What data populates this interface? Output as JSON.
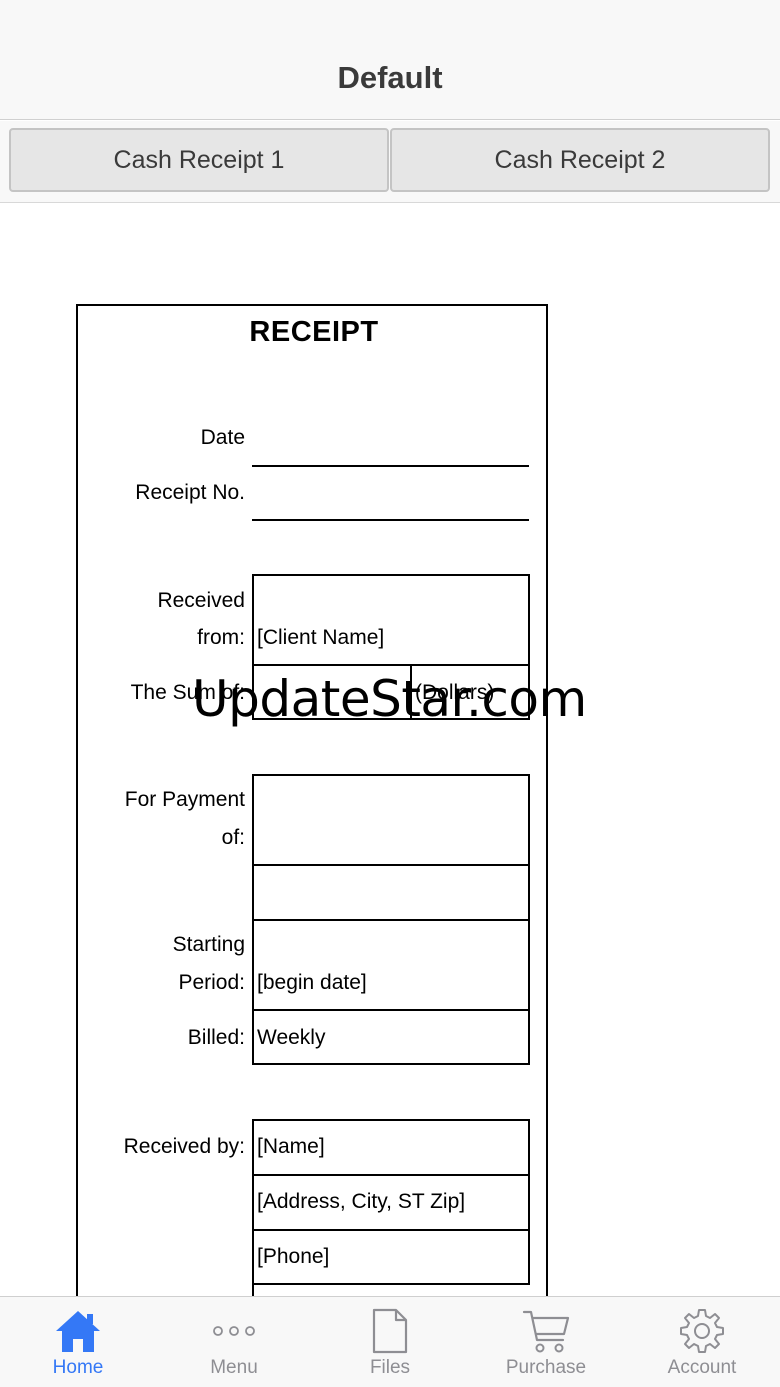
{
  "header": {
    "title": "Default"
  },
  "segments": {
    "items": [
      {
        "label": "Cash Receipt 1"
      },
      {
        "label": "Cash Receipt 2"
      }
    ]
  },
  "receipt": {
    "title": "RECEIPT",
    "date_label": "Date",
    "receipt_no_label": "Receipt No.",
    "received_from_label_1": "Received",
    "received_from_label_2": "from:",
    "client_name": "[Client Name]",
    "sum_label": "The Sum of:",
    "dollars": "(Dollars)",
    "payment_label_1": "For Payment",
    "payment_label_2": "of:",
    "starting_label_1": "Starting",
    "starting_label_2": "Period:",
    "begin_date": "[begin date]",
    "billed_label": "Billed:",
    "billed_value": "Weekly",
    "received_by_label": "Received by:",
    "name": "[Name]",
    "address": "[Address, City, ST  Zip]",
    "phone": "[Phone]"
  },
  "watermark": {
    "text": "UpdateStar.com"
  },
  "tabbar": {
    "active_color": "#3478f6",
    "inactive_color": "#8e8e93",
    "items": [
      {
        "label": "Home",
        "icon": "home-icon"
      },
      {
        "label": "Menu",
        "icon": "more-icon"
      },
      {
        "label": "Files",
        "icon": "file-icon"
      },
      {
        "label": "Purchase",
        "icon": "cart-icon"
      },
      {
        "label": "Account",
        "icon": "gear-icon"
      }
    ]
  }
}
